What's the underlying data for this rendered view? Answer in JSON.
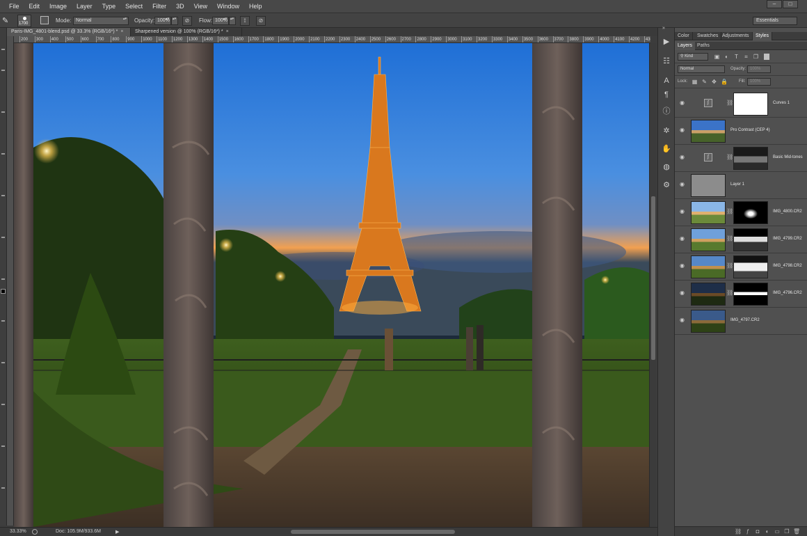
{
  "menu": [
    "File",
    "Edit",
    "Image",
    "Layer",
    "Type",
    "Select",
    "Filter",
    "3D",
    "View",
    "Window",
    "Help"
  ],
  "window_controls": {
    "minimize": "–",
    "maximize": "□"
  },
  "options": {
    "brush_size": "1700",
    "mode_label": "Mode:",
    "mode_value": "Normal",
    "opacity_label": "Opacity:",
    "opacity_value": "100%",
    "flow_label": "Flow:",
    "flow_value": "100%",
    "workspace": "Essentials"
  },
  "doc_tabs": [
    {
      "label": "Paris-IMG_4801-blend.psd @ 33.3% (RGB/16*) *",
      "close": "×"
    },
    {
      "label": "Sharpened version @ 100% (RGB/16*) *",
      "close": "×"
    }
  ],
  "ruler": [
    "200",
    "300",
    "400",
    "500",
    "600",
    "700",
    "800",
    "900",
    "1000",
    "1100",
    "1200",
    "1300",
    "1400",
    "1500",
    "1600",
    "1700",
    "1800",
    "1900",
    "2000",
    "2100",
    "2200",
    "2300",
    "2400",
    "2500",
    "2600",
    "2700",
    "2800",
    "2900",
    "3000",
    "3100",
    "3200",
    "3300",
    "3400",
    "3500",
    "3600",
    "3700",
    "3800",
    "3900",
    "4000",
    "4100",
    "4200",
    "4300"
  ],
  "status": {
    "zoom": "33.33%",
    "doc": "Doc: 105.9M/933.6M"
  },
  "panel_tabs": [
    "Color",
    "Swatches",
    "Adjustments",
    "Styles"
  ],
  "layer_tabs": [
    "Layers",
    "Paths"
  ],
  "layers_panel": {
    "filter_kind": "Kind",
    "blend_mode": "Normal",
    "opacity_label": "Opacity:",
    "opacity_value": "100%",
    "lock_label": "Lock:",
    "fill_label": "Fill:",
    "fill_value": "100%"
  },
  "layers": [
    {
      "name": "Curves 1",
      "kind": "adjustment"
    },
    {
      "name": "Pro Contrast (CEP 4)",
      "kind": "image"
    },
    {
      "name": "Basic Mid-tones",
      "kind": "adjustment"
    },
    {
      "name": "Layer 1",
      "kind": "gray"
    },
    {
      "name": "IMG_4800.CR2",
      "kind": "image-mask"
    },
    {
      "name": "IMG_4799.CR2",
      "kind": "image-mask"
    },
    {
      "name": "IMG_4798.CR2",
      "kind": "image-mask"
    },
    {
      "name": "IMG_4796.CR2",
      "kind": "image-mask"
    },
    {
      "name": "IMG_4797.CR2",
      "kind": "image"
    }
  ]
}
